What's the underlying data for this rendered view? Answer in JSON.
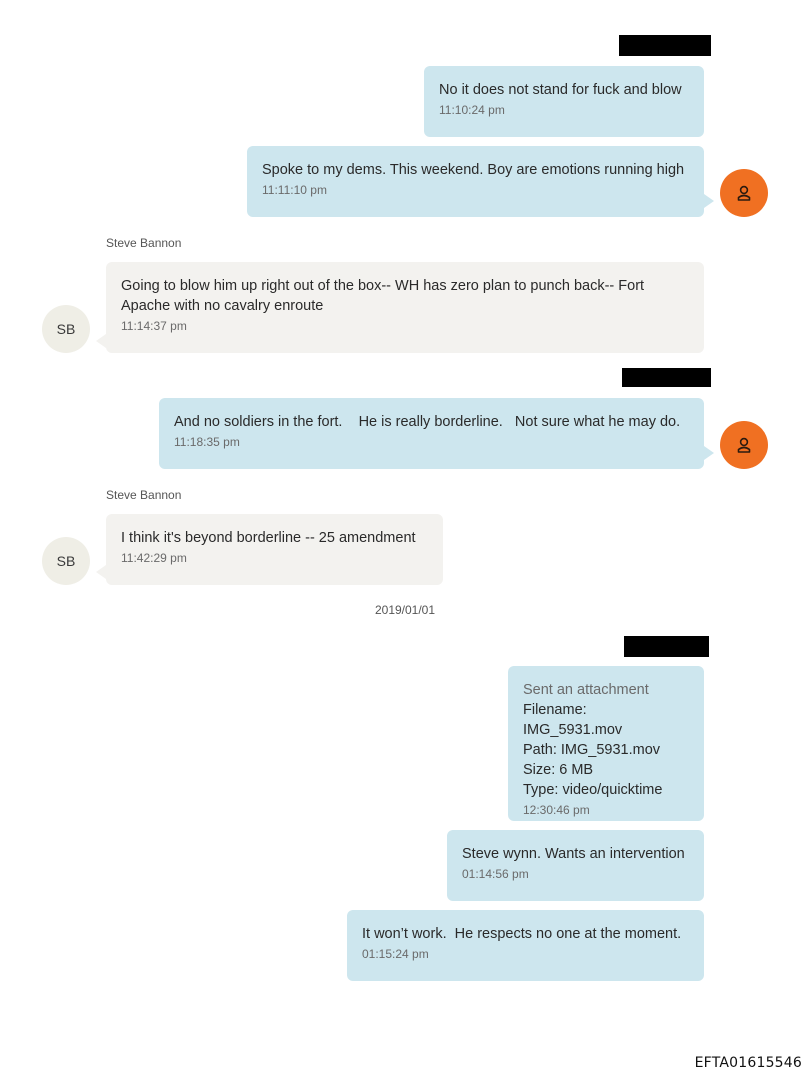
{
  "messages": [
    {
      "text": "No it does not stand for fuck and blow",
      "time": "11:10:24 pm"
    },
    {
      "text": "Spoke to my dems. This weekend. Boy are emotions running high",
      "time": "11:11:10 pm"
    },
    {
      "sender": "Steve Bannon",
      "text": "Going to blow him up right out of the box-- WH has zero plan to punch back-- Fort Apache with no cavalry enroute",
      "time": "11:14:37 pm",
      "avatar": "SB"
    },
    {
      "text": "And no soldiers in the fort.    He is really borderline.   Not sure what he may do.",
      "time": "11:18:35 pm"
    },
    {
      "sender": "Steve Bannon",
      "text": "I think it's beyond borderline -- 25 amendment",
      "time": "11:42:29 pm",
      "avatar": "SB"
    },
    {
      "attachment": {
        "header": "Sent an attachment",
        "filename": "Filename: IMG_5931.mov",
        "path": "Path: IMG_5931.mov",
        "size": "Size: 6 MB",
        "type": "Type: video/quicktime"
      },
      "time": "12:30:46 pm"
    },
    {
      "text": "Steve wynn. Wants an intervention",
      "time": "01:14:56 pm"
    },
    {
      "text": "It won’t work.  He respects no one at the moment.",
      "time": "01:15:24 pm"
    }
  ],
  "date_separator": "2019/01/01",
  "footer_id": "EFTA01615546",
  "icons": {
    "user_avatar": "person-icon"
  },
  "colors": {
    "outgoing_bubble": "#cde6ee",
    "incoming_bubble": "#f3f2ef",
    "user_avatar": "#f07022",
    "contact_avatar": "#efeee6",
    "redaction": "#000000"
  }
}
